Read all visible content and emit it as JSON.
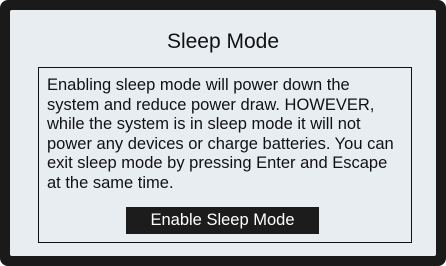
{
  "dialog": {
    "title": "Sleep Mode",
    "message": "Enabling sleep mode will power down the system and reduce power draw. HOWEVER, while the system is in sleep mode it will not power any devices or charge batteries. You can exit sleep mode by pressing Enter and Escape at the same time.",
    "enable_button_label": "Enable Sleep Mode"
  },
  "colors": {
    "bezel": "#1a1a1a",
    "screen_background": "#e8edf2",
    "text": "#111111",
    "button_background": "#1c1c1c",
    "button_text": "#ffffff"
  }
}
